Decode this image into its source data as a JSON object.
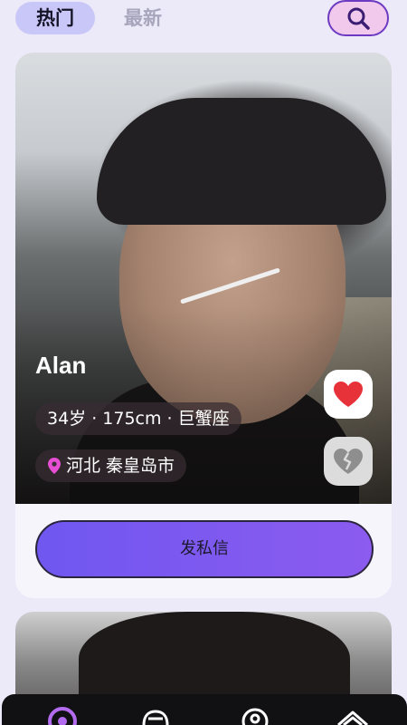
{
  "tabs": [
    {
      "label": "热门",
      "active": true
    },
    {
      "label": "最新",
      "active": false
    }
  ],
  "search": {
    "icon": "search-icon"
  },
  "profile": {
    "name": "Alan",
    "info": "34岁 · 175cm · 巨蟹座",
    "location": "河北 秦皇岛市"
  },
  "actions": {
    "like_icon": "heart-icon",
    "dislike_icon": "broken-heart-icon"
  },
  "message_button": {
    "label": "发私信"
  },
  "bottom_nav": {
    "items": [
      {
        "icon": "home-icon",
        "active": true
      },
      {
        "icon": "message-icon",
        "active": false
      },
      {
        "icon": "location-icon",
        "active": false
      },
      {
        "icon": "profile-icon",
        "active": false
      }
    ]
  },
  "colors": {
    "background": "#ece9f8",
    "tab_active_bg": "#c9c7f7",
    "search_bg": "#f0c9ec",
    "accent": "#6d3ac2",
    "like": "#e8323a",
    "button_gradient_start": "#6f57f0",
    "button_gradient_end": "#8c5bef"
  }
}
